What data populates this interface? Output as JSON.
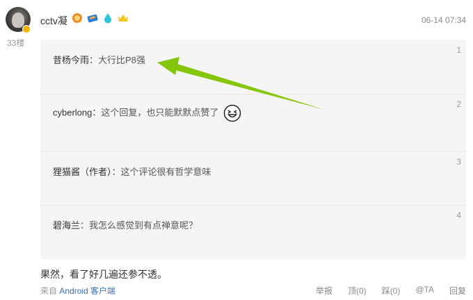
{
  "post": {
    "username": "cctv凝",
    "floor": "33楼",
    "timestamp": "06-14 07:34",
    "content": "果然，看了好几遍还参不透。",
    "source_prefix": "来自",
    "source_link": "Android 客户端"
  },
  "badges": [
    "orange-medal-icon",
    "ticket-icon",
    "water-drop-icon",
    "crown-icon"
  ],
  "replies": [
    {
      "author": "昔杨今雨",
      "text": "：大行比P8强",
      "num": "1"
    },
    {
      "author": "cyberlong",
      "text": "：这个回复，也只能默默点赞了",
      "num": "2",
      "emoji": "grinning-face-icon"
    },
    {
      "author": "狸猫酱（作者）",
      "text": "：这个评论很有哲学意味",
      "num": "3"
    },
    {
      "author": "碧海兰",
      "text": "：我怎么感觉到有点禅意呢？",
      "num": "4"
    }
  ],
  "actions": {
    "report": "举报",
    "up": "顶(0)",
    "down": "踩(0)",
    "mention": "@TA",
    "reply": "回复"
  },
  "colors": {
    "arrow": "#86c60a",
    "link": "#3b6fb6",
    "reply_bg": "#f5f5f5"
  }
}
